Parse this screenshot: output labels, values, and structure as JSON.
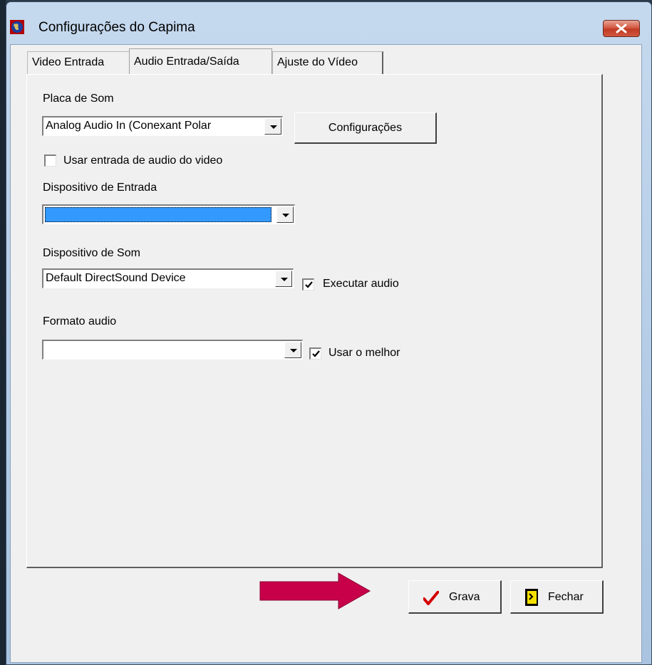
{
  "window": {
    "title": "Configurações do Capima"
  },
  "tabs": [
    {
      "label": "Video Entrada"
    },
    {
      "label": "Audio Entrada/Saída"
    },
    {
      "label": "Ajuste do Vídeo"
    }
  ],
  "active_tab": "Audio Entrada/Saída",
  "audio": {
    "sound_card_label": "Placa de Som",
    "sound_card_value": "Analog Audio In (Conexant Polar",
    "config_button": "Configurações",
    "use_video_audio_label": "Usar entrada de audio do video",
    "use_video_audio_checked": false,
    "input_device_label": "Dispositivo de Entrada",
    "input_device_value": "",
    "sound_device_label": "Dispositivo de Som",
    "sound_device_value": "Default DirectSound Device",
    "play_audio_label": "Executar audio",
    "play_audio_checked": true,
    "format_label": "Formato audio",
    "format_value": "",
    "use_best_label": "Usar o melhor",
    "use_best_checked": true
  },
  "footer": {
    "save_button": "Grava",
    "close_button": "Fechar"
  },
  "colors": {
    "selection": "#3399ff",
    "annotation_arrow": "#c8004a"
  }
}
